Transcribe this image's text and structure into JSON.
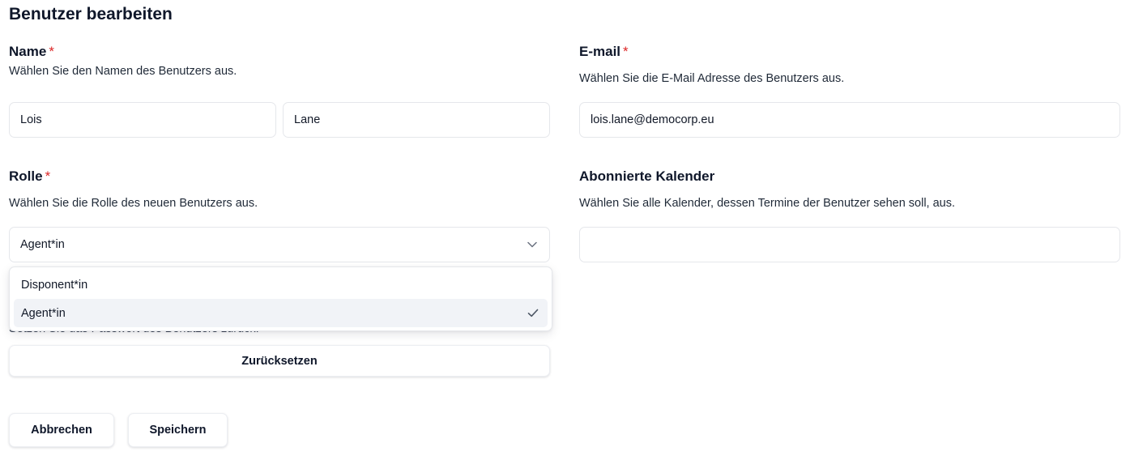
{
  "page": {
    "title": "Benutzer bearbeiten"
  },
  "name_field": {
    "label": "Name",
    "required_mark": "*",
    "description": "Wählen Sie den Namen des Benutzers aus.",
    "first_name_value": "Lois",
    "last_name_value": "Lane"
  },
  "email_field": {
    "label": "E-mail",
    "required_mark": "*",
    "description": "Wählen Sie die E-Mail Adresse des Benutzers aus.",
    "value": "lois.lane@democorp.eu"
  },
  "role_field": {
    "label": "Rolle",
    "required_mark": "*",
    "description": "Wählen Sie die Rolle des neuen Benutzers aus.",
    "selected_value": "Agent*in",
    "dropdown_icon": "chevron-down-icon",
    "options": [
      {
        "label": "Disponent*in",
        "selected": false
      },
      {
        "label": "Agent*in",
        "selected": true,
        "icon": "check-icon"
      }
    ]
  },
  "calendar_field": {
    "label": "Abonnierte Kalender",
    "description": "Wählen Sie alle Kalender, dessen Termine der Benutzer sehen soll, aus.",
    "value": ""
  },
  "password_field": {
    "description": "Setzen Sie das Passwort des Benutzers zurück.",
    "reset_button_label": "Zurücksetzen"
  },
  "actions": {
    "cancel_label": "Abbrechen",
    "save_label": "Speichern"
  },
  "colors": {
    "required": "#dc2626",
    "selected_option_bg": "#f1f3f7",
    "border": "#e5e7eb"
  }
}
